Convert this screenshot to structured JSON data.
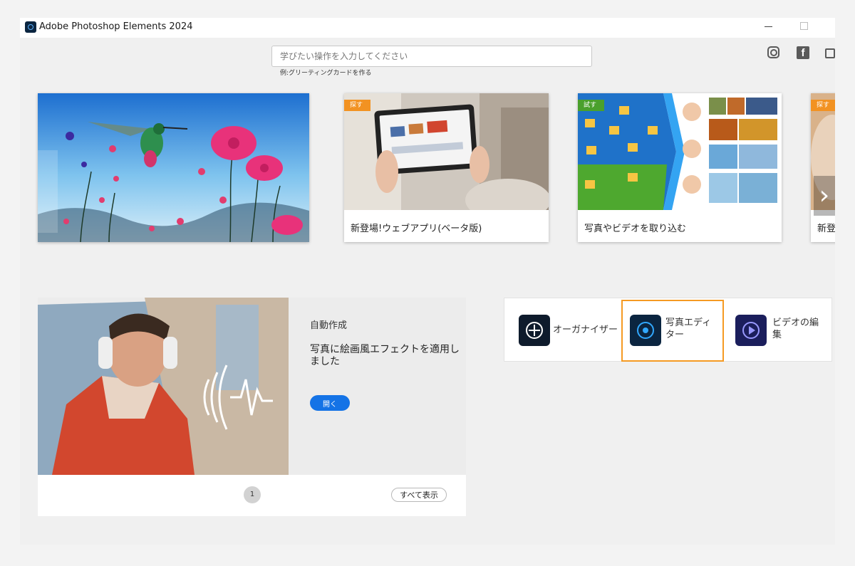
{
  "window": {
    "title": "Adobe Photoshop Elements 2024"
  },
  "search": {
    "placeholder": "学びたい操作を入力してください",
    "example": "例:グリーティングカードを作る"
  },
  "social": [
    "instagram-icon",
    "facebook-icon",
    "feedback-icon"
  ],
  "carousel": [
    {
      "label": "",
      "badge": ""
    },
    {
      "label": "新登場!ウェブアプリ(ベータ版)",
      "badge": "探す",
      "badge_color": "#f29222"
    },
    {
      "label": "写真やビデオを取り込む",
      "badge": "試す",
      "badge_color": "#4aa02c"
    },
    {
      "label": "新登",
      "badge": "探す",
      "badge_color": "#f29222"
    }
  ],
  "facebook_glyph": "f",
  "next_glyph": "›",
  "promo": {
    "category": "自動作成",
    "title": "写真に絵画風エフェクトを適用しました",
    "open_label": "開く",
    "page": "1",
    "show_all_label": "すべて表示"
  },
  "launchers": [
    {
      "label": "オーガナイザー",
      "icon": "organizer-icon",
      "selected": false
    },
    {
      "label": "写真エディター",
      "icon": "photo-editor-icon",
      "selected": true
    },
    {
      "label": "ビデオの編集",
      "icon": "video-editor-icon",
      "selected": false
    }
  ],
  "colors": {
    "accent": "#1473e6",
    "selection": "#f59a23",
    "badge_orange": "#f29222",
    "badge_green": "#4aa02c"
  }
}
